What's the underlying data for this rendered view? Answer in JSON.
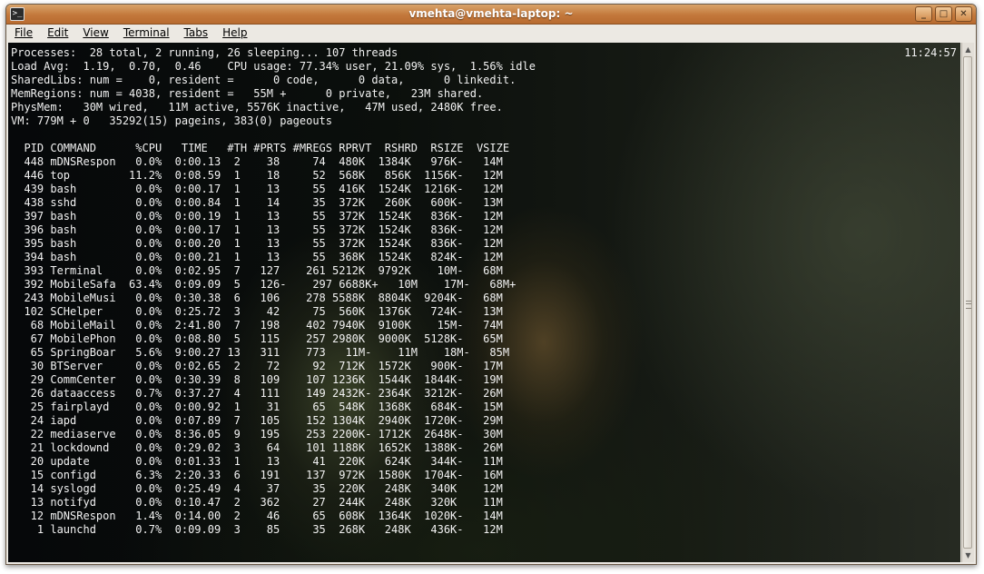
{
  "window": {
    "title": "vmehta@vmehta-laptop: ~",
    "controls": {
      "minimize": "_",
      "maximize": "□",
      "close": "✕"
    }
  },
  "menu": {
    "file": "File",
    "edit": "Edit",
    "view": "View",
    "terminal": "Terminal",
    "tabs": "Tabs",
    "help": "Help"
  },
  "terminal": {
    "clock": "11:24:57",
    "summary": [
      "Processes:  28 total, 2 running, 26 sleeping... 107 threads",
      "Load Avg:  1.19,  0.70,  0.46    CPU usage: 77.34% user, 21.09% sys,  1.56% idle",
      "SharedLibs: num =    0, resident =      0 code,      0 data,      0 linkedit.",
      "MemRegions: num = 4038, resident =   55M +      0 private,   23M shared.",
      "PhysMem:   30M wired,   11M active, 5576K inactive,   47M used, 2480K free.",
      "VM: 779M + 0   35292(15) pageins, 383(0) pageouts"
    ],
    "header": "  PID COMMAND      %CPU   TIME   #TH #PRTS #MREGS RPRVT  RSHRD  RSIZE  VSIZE",
    "rows": [
      "  448 mDNSRespon   0.0%  0:00.13  2    38     74  480K  1384K   976K-   14M",
      "  446 top         11.2%  0:08.59  1    18     52  568K   856K  1156K-   12M",
      "  439 bash         0.0%  0:00.17  1    13     55  416K  1524K  1216K-   12M",
      "  438 sshd         0.0%  0:00.84  1    14     35  372K   260K   600K-   13M",
      "  397 bash         0.0%  0:00.19  1    13     55  372K  1524K   836K-   12M",
      "  396 bash         0.0%  0:00.17  1    13     55  372K  1524K   836K-   12M",
      "  395 bash         0.0%  0:00.20  1    13     55  372K  1524K   836K-   12M",
      "  394 bash         0.0%  0:00.21  1    13     55  368K  1524K   824K-   12M",
      "  393 Terminal     0.0%  0:02.95  7   127    261 5212K  9792K    10M-   68M",
      "  392 MobileSafa  63.4%  0:09.09  5   126-    297 6688K+   10M    17M-   68M+",
      "  243 MobileMusi   0.0%  0:30.38  6   106    278 5588K  8804K  9204K-   68M",
      "  102 SCHelper     0.0%  0:25.72  3    42     75  560K  1376K   724K-   13M",
      "   68 MobileMail   0.0%  2:41.80  7   198    402 7940K  9100K    15M-   74M",
      "   67 MobilePhon   0.0%  0:08.80  5   115    257 2980K  9000K  5128K-   65M",
      "   65 SpringBoar   5.6%  9:00.27 13   311    773   11M-    11M    18M-   85M",
      "   30 BTServer     0.0%  0:02.65  2    72     92  712K  1572K   900K-   17M",
      "   29 CommCenter   0.0%  0:30.39  8   109    107 1236K  1544K  1844K-   19M",
      "   26 dataaccess   0.7%  0:37.27  4   111    149 2432K- 2364K  3212K-   26M",
      "   25 fairplayd    0.0%  0:00.92  1    31     65  548K  1368K   684K-   15M",
      "   24 iapd         0.0%  0:07.89  7   105    152 1304K  2940K  1720K-   29M",
      "   22 mediaserve   0.0%  8:36.05  9   195    253 2200K- 1712K  2648K-   30M",
      "   21 lockdownd    0.0%  0:29.02  3    64    101 1188K  1652K  1388K-   26M",
      "   20 update       0.0%  0:01.33  1    13     41  220K   624K   344K-   11M",
      "   15 configd      6.3%  2:20.33  6   191    137  972K  1580K  1704K-   16M",
      "   14 syslogd      0.0%  0:25.49  4    37     35  220K   248K   340K    12M",
      "   13 notifyd      0.0%  0:10.47  2   362     27  244K   248K   320K    11M",
      "   12 mDNSRespon   1.4%  0:14.00  2    46     65  608K  1364K  1020K-   14M",
      "    1 launchd      0.7%  0:09.09  3    85     35  268K   248K   436K-   12M"
    ]
  }
}
